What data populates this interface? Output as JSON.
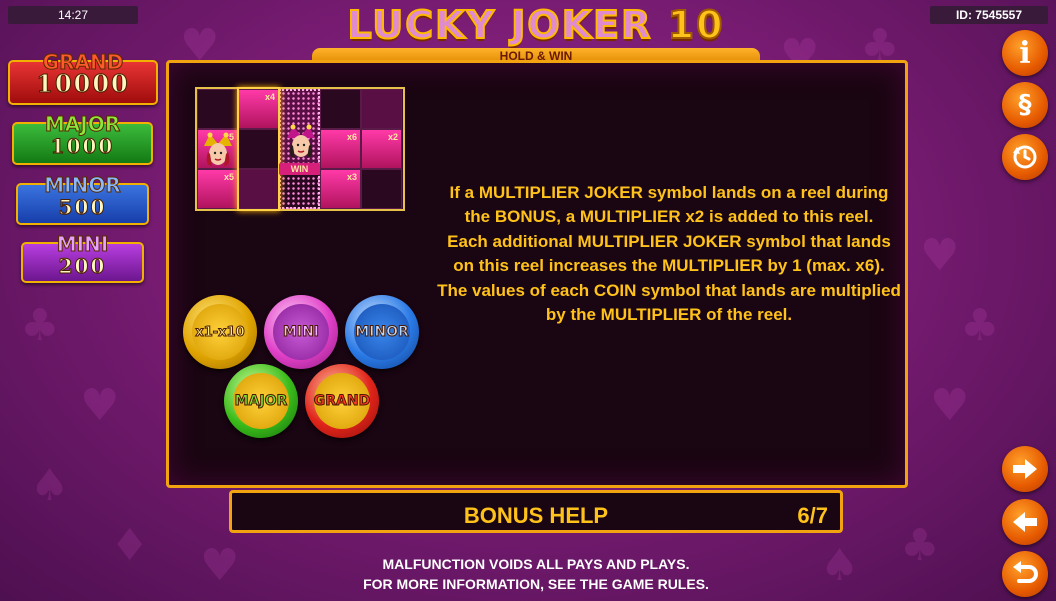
{
  "status": {
    "time": "14:27",
    "session_id": "ID: 7545557"
  },
  "logo": {
    "title": "LUCKY JOKER",
    "number": "10",
    "subtitle": "HOLD & WIN"
  },
  "jackpots": [
    {
      "name": "GRAND",
      "value": "10000"
    },
    {
      "name": "MAJOR",
      "value": "1000"
    },
    {
      "name": "MINOR",
      "value": "500"
    },
    {
      "name": "MINI",
      "value": "200"
    }
  ],
  "side_buttons": {
    "info": "i",
    "rules": "§",
    "history": "history-icon",
    "next": "arrow-right-icon",
    "prev": "arrow-left-icon",
    "back": "return-icon"
  },
  "example_grid": {
    "multipliers": [
      "x4",
      "x5",
      "x6",
      "x2",
      "x5",
      "x3"
    ],
    "win_label": "WIN"
  },
  "coins": [
    "x1-x10",
    "MINI",
    "MINOR",
    "MAJOR",
    "GRAND"
  ],
  "help_text": [
    "If a MULTIPLIER JOKER symbol lands on a reel during the BONUS, a MULTIPLIER x2 is added to this reel.",
    "Each additional MULTIPLIER JOKER symbol that lands on this reel increases the MULTIPLIER by 1 (max. x6).",
    "The values of each COIN symbol that lands are multiplied by the MULTIPLIER of the reel."
  ],
  "help_bar": {
    "title": "BONUS HELP",
    "page": "6/7"
  },
  "disclaimer": {
    "line1": "MALFUNCTION VOIDS ALL PAYS AND PLAYS.",
    "line2": "FOR MORE INFORMATION, SEE THE GAME RULES."
  },
  "colors": {
    "accent": "#f2a410",
    "help_text": "#ffc21a",
    "background": "#7a1c74"
  }
}
